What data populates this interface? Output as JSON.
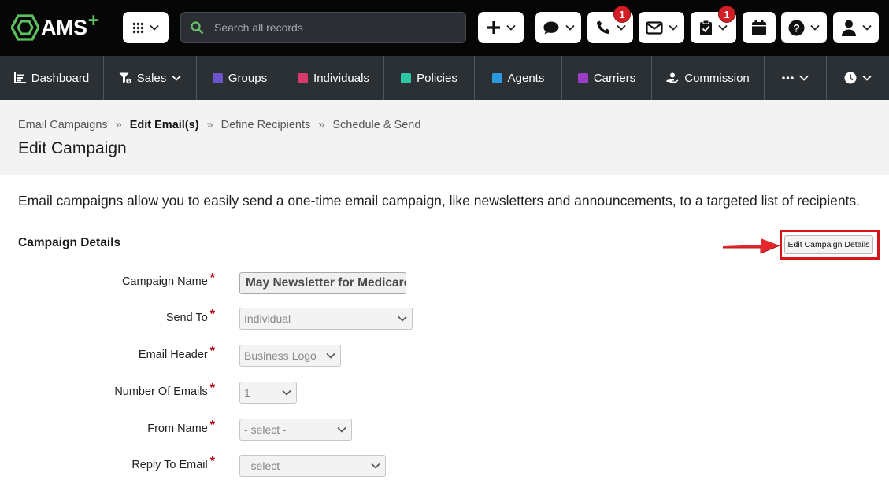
{
  "app": {
    "logo_text": "AMS",
    "logo_plus": "+"
  },
  "topbar": {
    "search_placeholder": "Search all records",
    "phone_badge": "1",
    "tasks_badge": "1"
  },
  "nav": {
    "items": [
      {
        "label": "Dashboard"
      },
      {
        "label": "Sales"
      },
      {
        "label": "Groups",
        "color": "#6d55c9"
      },
      {
        "label": "Individuals",
        "color": "#d83a6a"
      },
      {
        "label": "Policies",
        "color": "#2fc6a6"
      },
      {
        "label": "Agents",
        "color": "#2d9ae0"
      },
      {
        "label": "Carriers",
        "color": "#9a3ec9"
      },
      {
        "label": "Commission"
      }
    ]
  },
  "breadcrumb": {
    "items": [
      "Email Campaigns",
      "Edit Email(s)",
      "Define Recipients",
      "Schedule & Send"
    ],
    "separator": "»"
  },
  "page": {
    "title": "Edit Campaign",
    "intro": "Email campaigns allow you to easily send a one-time email campaign, like newsletters and announcements, to a targeted list of recipients."
  },
  "section": {
    "title": "Campaign Details",
    "edit_button": "Edit Campaign Details"
  },
  "form": {
    "required_mark": "*",
    "campaign_name": {
      "label": "Campaign Name",
      "value": "May Newsletter for Medicare"
    },
    "send_to": {
      "label": "Send To",
      "value": "Individual"
    },
    "email_header": {
      "label": "Email Header",
      "value": "Business Logo"
    },
    "number_of_emails": {
      "label": "Number Of Emails",
      "value": "1"
    },
    "from_name": {
      "label": "From Name",
      "value": "- select -"
    },
    "reply_to_email": {
      "label": "Reply To Email",
      "value": "- select -"
    }
  }
}
